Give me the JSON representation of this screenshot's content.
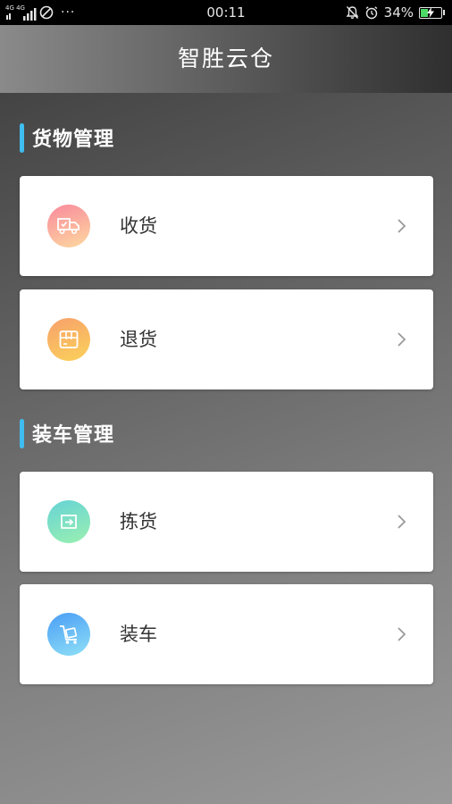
{
  "status_bar": {
    "network": "4G 4G",
    "time": "00:11",
    "battery_percent": "34%",
    "dots": "···",
    "battery_level": 0.34,
    "battery_color": "#4cd964"
  },
  "header": {
    "title": "智胜云仓"
  },
  "sections": [
    {
      "title": "货物管理",
      "items": [
        {
          "label": "收货",
          "icon": "delivery-truck-icon",
          "colors": [
            "#f9899c",
            "#fdd9a0"
          ]
        },
        {
          "label": "退货",
          "icon": "return-box-icon",
          "colors": [
            "#f7a06b",
            "#fbd25a"
          ]
        }
      ]
    },
    {
      "title": "装车管理",
      "items": [
        {
          "label": "拣货",
          "icon": "pick-export-icon",
          "colors": [
            "#66d3d6",
            "#9af0b0"
          ]
        },
        {
          "label": "装车",
          "icon": "hand-cart-icon",
          "colors": [
            "#4a9df5",
            "#8fe0f7"
          ]
        }
      ]
    }
  ],
  "accent_color": "#3fbdf0"
}
